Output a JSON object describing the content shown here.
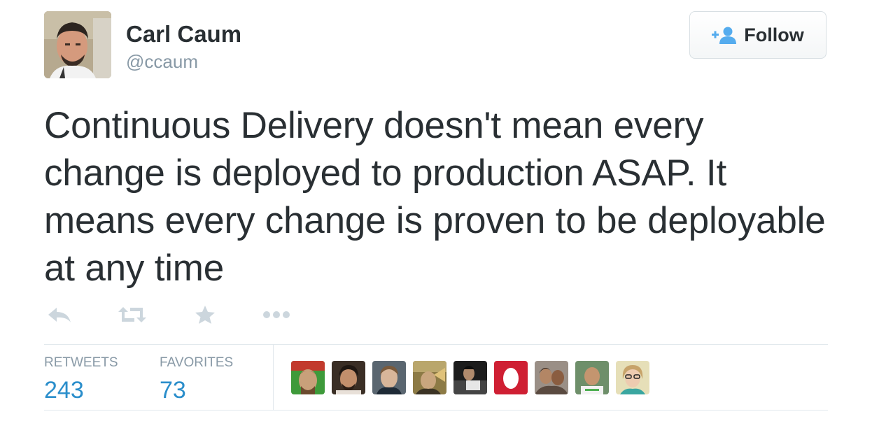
{
  "user": {
    "display_name": "Carl Caum",
    "handle": "@ccaum",
    "avatar_icon": "profile-photo"
  },
  "follow_button": {
    "label": "Follow",
    "icon": "add-user-icon",
    "icon_color": "#55acee"
  },
  "tweet": {
    "text": "Continuous Delivery doesn't mean every change is deployed to production ASAP. It means every change is proven to be deployable at any time"
  },
  "actions": [
    {
      "name": "reply",
      "icon": "reply-icon"
    },
    {
      "name": "retweet",
      "icon": "retweet-icon"
    },
    {
      "name": "favorite",
      "icon": "star-icon"
    },
    {
      "name": "more",
      "icon": "more-icon"
    }
  ],
  "stats": {
    "retweets_label": "RETWEETS",
    "retweets_count": "243",
    "favorites_label": "FAVORITES",
    "favorites_count": "73"
  },
  "colors": {
    "text": "#292f33",
    "muted": "#8899a6",
    "link": "#2a8ecb",
    "action_icon": "#ccd6dd",
    "divider": "#e1e8ed"
  },
  "favoriter_avatars": [
    "favoriter-avatar-1",
    "favoriter-avatar-2",
    "favoriter-avatar-3",
    "favoriter-avatar-4",
    "favoriter-avatar-5",
    "favoriter-avatar-6",
    "favoriter-avatar-7",
    "favoriter-avatar-8",
    "favoriter-avatar-9"
  ]
}
